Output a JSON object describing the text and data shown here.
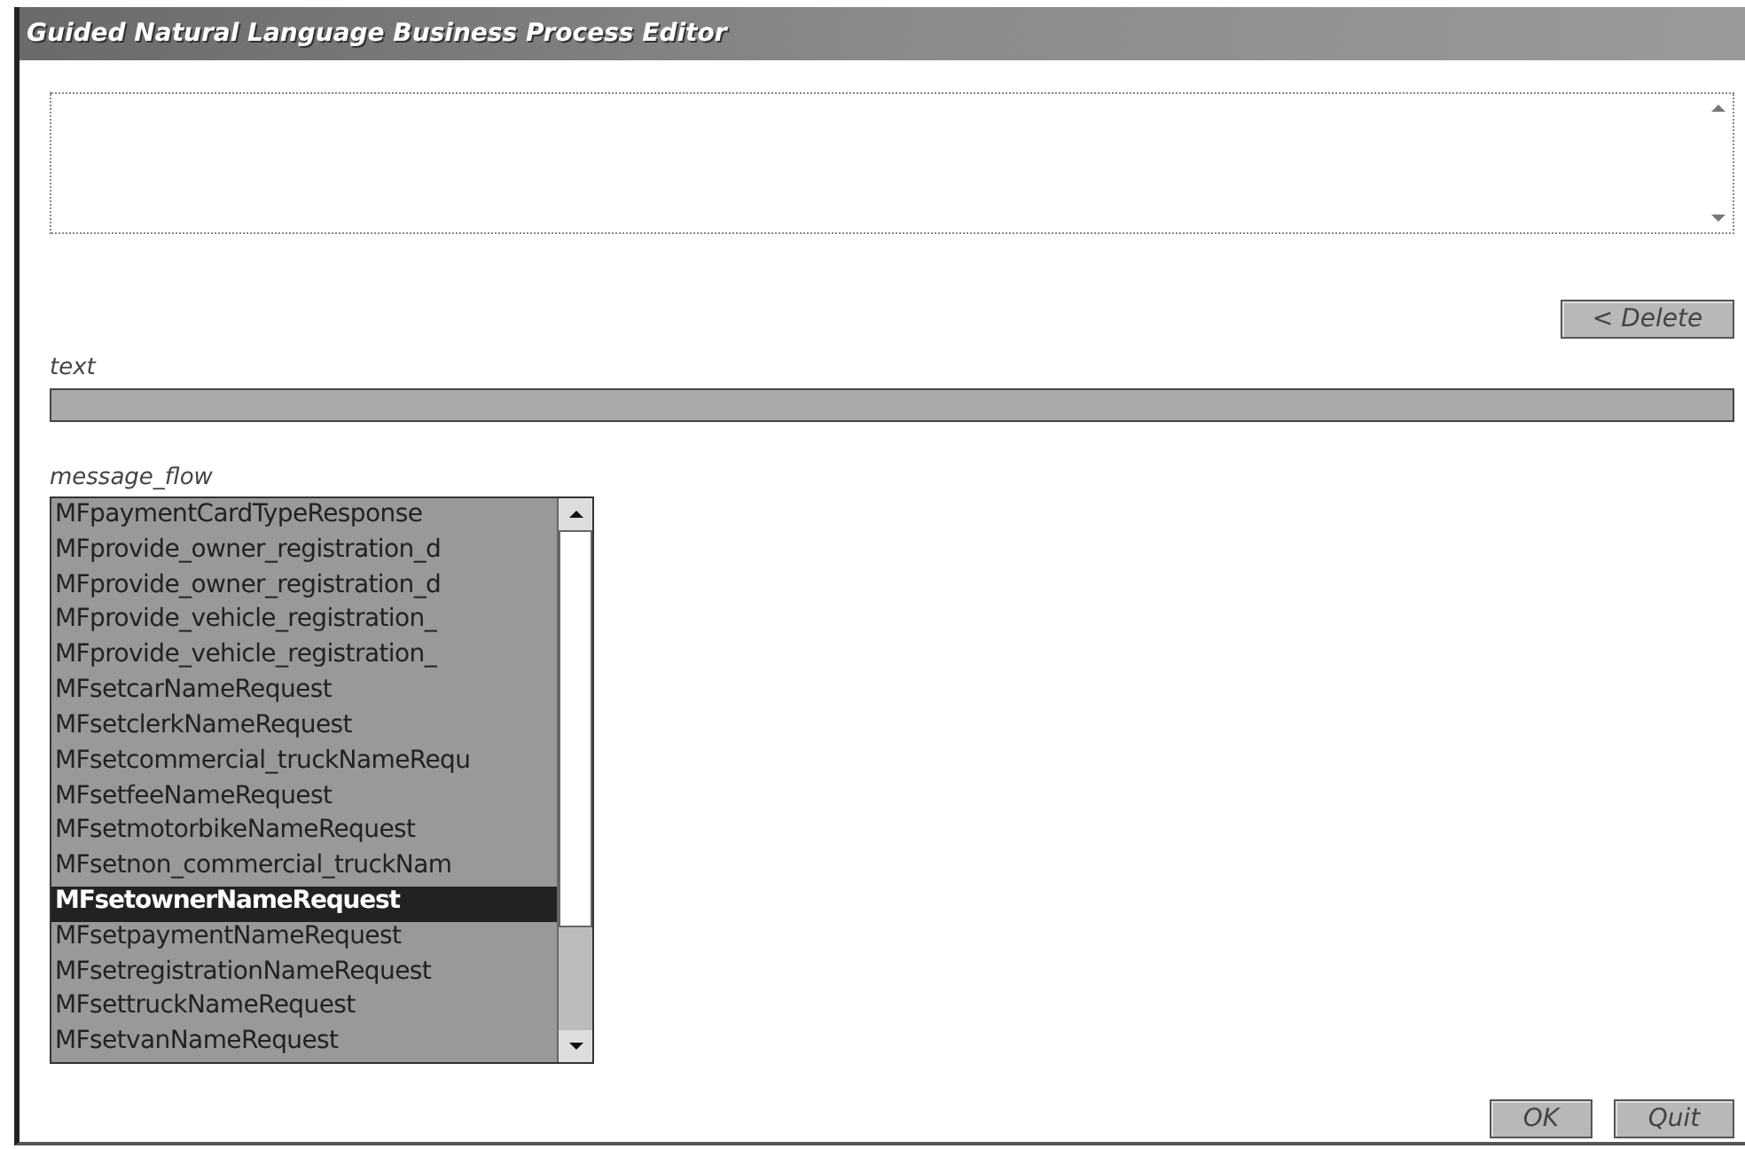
{
  "window": {
    "title": "Guided Natural Language Business Process Editor"
  },
  "delete_button": {
    "label": "< Delete"
  },
  "text_field": {
    "label": "text"
  },
  "message_flow": {
    "label": "message_flow",
    "items": [
      {
        "label": "MFpaymentCardTypeResponse",
        "selected": false
      },
      {
        "label": "MFprovide_owner_registration_d",
        "selected": false
      },
      {
        "label": "MFprovide_owner_registration_d",
        "selected": false
      },
      {
        "label": "MFprovide_vehicle_registration_",
        "selected": false
      },
      {
        "label": "MFprovide_vehicle_registration_",
        "selected": false
      },
      {
        "label": "MFsetcarNameRequest",
        "selected": false
      },
      {
        "label": "MFsetclerkNameRequest",
        "selected": false
      },
      {
        "label": "MFsetcommercial_truckNameRequ",
        "selected": false
      },
      {
        "label": "MFsetfeeNameRequest",
        "selected": false
      },
      {
        "label": "MFsetmotorbikeNameRequest",
        "selected": false
      },
      {
        "label": "MFsetnon_commercial_truckNam",
        "selected": false
      },
      {
        "label": "MFsetownerNameRequest",
        "selected": true
      },
      {
        "label": "MFsetpaymentNameRequest",
        "selected": false
      },
      {
        "label": "MFsetregistrationNameRequest",
        "selected": false
      },
      {
        "label": "MFsettruckNameRequest",
        "selected": false
      },
      {
        "label": "MFsetvanNameRequest",
        "selected": false
      }
    ]
  },
  "buttons": [
    {
      "label": "OK"
    },
    {
      "label": "Quit"
    }
  ]
}
